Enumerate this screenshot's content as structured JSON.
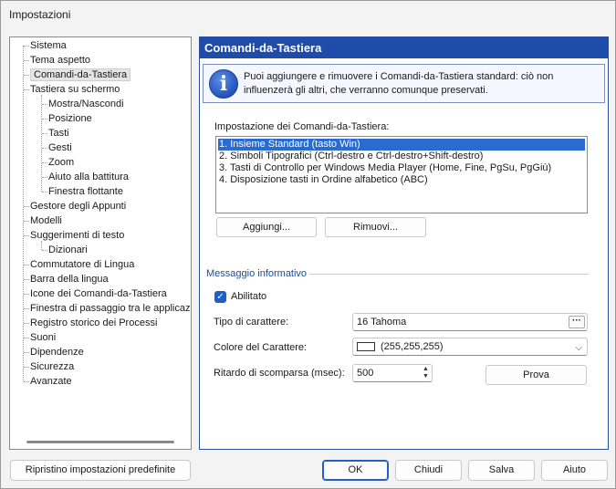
{
  "window": {
    "title": "Impostazioni"
  },
  "tree": {
    "items": [
      {
        "label": "Sistema",
        "level": 0
      },
      {
        "label": "Tema aspetto",
        "level": 0
      },
      {
        "label": "Comandi-da-Tastiera",
        "level": 0,
        "selected": true
      },
      {
        "label": "Tastiera su schermo",
        "level": 0
      },
      {
        "label": "Mostra/Nascondi",
        "level": 1
      },
      {
        "label": "Posizione",
        "level": 1
      },
      {
        "label": "Tasti",
        "level": 1
      },
      {
        "label": "Gesti",
        "level": 1
      },
      {
        "label": "Zoom",
        "level": 1
      },
      {
        "label": "Aiuto alla battitura",
        "level": 1
      },
      {
        "label": "Finestra flottante",
        "level": 1
      },
      {
        "label": "Gestore degli Appunti",
        "level": 0
      },
      {
        "label": "Modelli",
        "level": 0
      },
      {
        "label": "Suggerimenti di testo",
        "level": 0
      },
      {
        "label": "Dizionari",
        "level": 1
      },
      {
        "label": "Commutatore di Lingua",
        "level": 0
      },
      {
        "label": "Barra della lingua",
        "level": 0
      },
      {
        "label": "Icone dei Comandi-da-Tastiera",
        "level": 0
      },
      {
        "label": "Finestra di passaggio tra le applicazioni",
        "level": 0
      },
      {
        "label": "Registro storico dei Processi",
        "level": 0
      },
      {
        "label": "Suoni",
        "level": 0
      },
      {
        "label": "Dipendenze",
        "level": 0
      },
      {
        "label": "Sicurezza",
        "level": 0
      },
      {
        "label": "Avanzate",
        "level": 0
      }
    ]
  },
  "panel": {
    "header": "Comandi-da-Tastiera",
    "info_text": "Puoi aggiungere e rimuovere i Comandi-da-Tastiera standard: ciò non influenzerà gli altri, che verranno comunque preservati.",
    "setup_label": "Impostazione dei Comandi-da-Tastiera:",
    "list": [
      "1. Insieme Standard (tasto Win)",
      "2. Simboli Tipografici (Ctrl-destro e Ctrl-destro+Shift-destro)",
      "3. Tasti di Controllo per Windows Media Player (Home, Fine, PgSu, PgGiù)",
      "4. Disposizione tasti in Ordine alfabetico (ABC)"
    ],
    "add_button": "Aggiungi...",
    "remove_button": "Rimuovi...",
    "group_title": "Messaggio informativo",
    "enabled_label": "Abilitato",
    "font_label": "Tipo di carattere:",
    "font_value": "16 Tahoma",
    "dots": "···",
    "color_label": "Colore del Carattere:",
    "color_value": "(255,255,255)",
    "color_swatch": "#ffffff",
    "delay_label": "Ritardo di scomparsa (msec):",
    "delay_value": "500",
    "test_button": "Prova"
  },
  "footer": {
    "reset_button": "Ripristino impostazioni predefinite",
    "ok_button": "OK",
    "close_button": "Chiudi",
    "save_button": "Salva",
    "help_button": "Aiuto"
  },
  "colors": {
    "accent": "#1f4ca8",
    "selection": "#2a6bd1"
  }
}
